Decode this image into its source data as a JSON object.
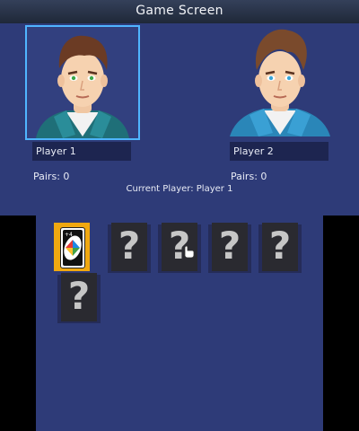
{
  "title": "Game Screen",
  "players": [
    {
      "name": "Player 1",
      "pairs_label": "Pairs: 0",
      "eye_color": "#3ca84a"
    },
    {
      "name": "Player 2",
      "pairs_label": "Pairs: 0",
      "eye_color": "#3aa6d8"
    }
  ],
  "current_player_label": "Current Player: Player 1",
  "cards": [
    {
      "state": "face-up",
      "face": "wild-card-icon"
    },
    {
      "state": "face-down",
      "label": "?"
    },
    {
      "state": "face-down",
      "label": "?"
    },
    {
      "state": "face-down",
      "label": "?"
    },
    {
      "state": "face-down",
      "label": "?"
    },
    {
      "state": "face-down",
      "label": "?"
    }
  ],
  "colors": {
    "background": "#2e3b78",
    "highlight": "#4fb5ff",
    "selected_card": "#f0a810",
    "card_back": "#2a2a30"
  }
}
